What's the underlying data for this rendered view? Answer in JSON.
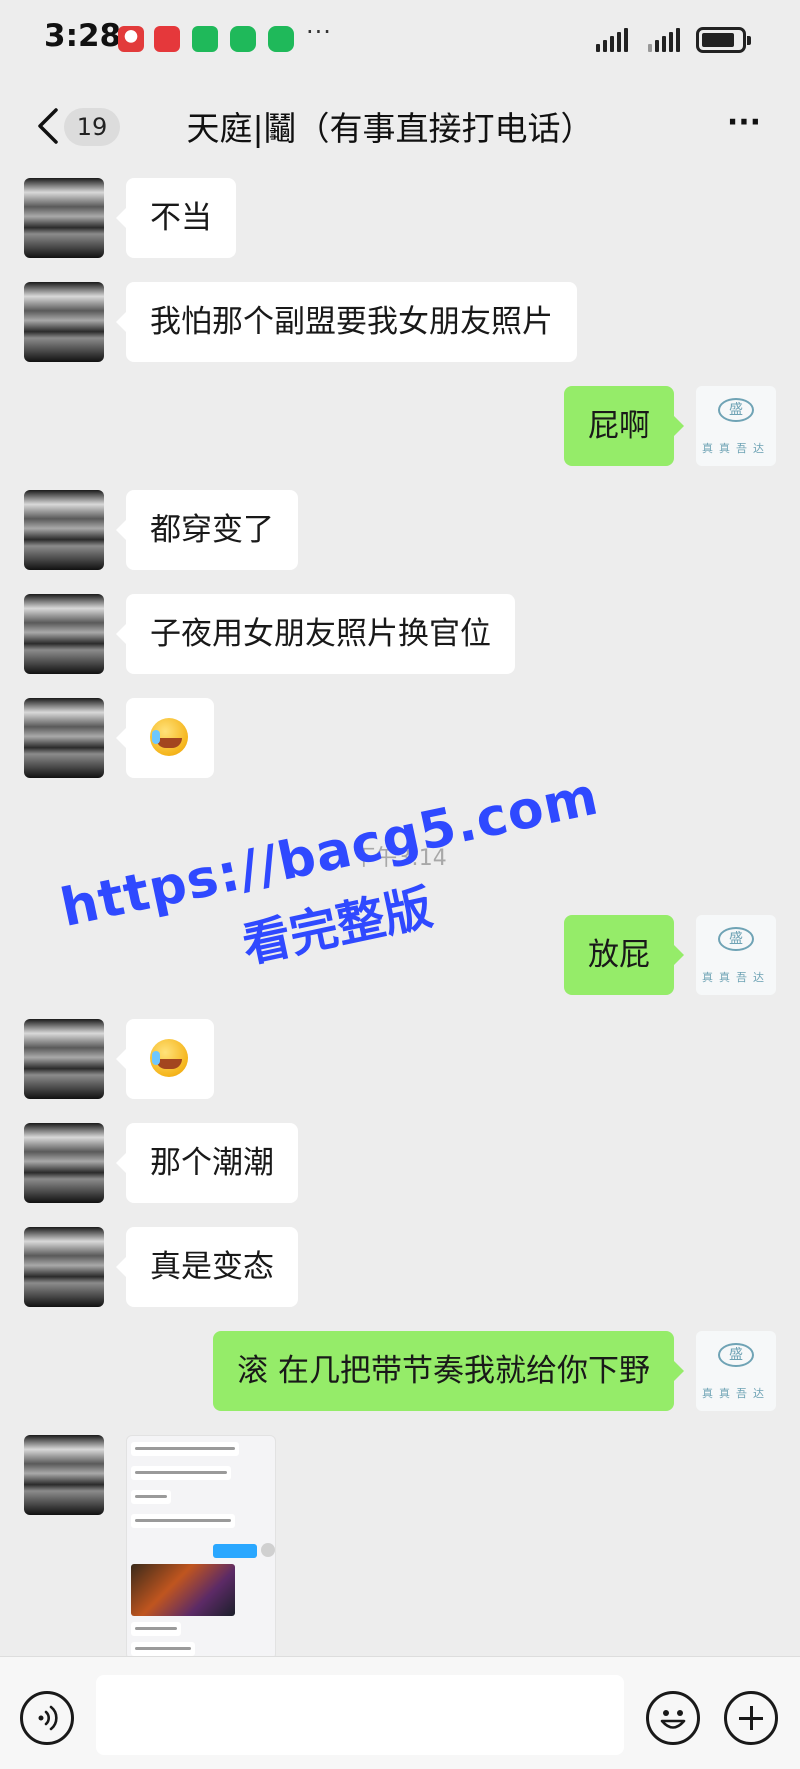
{
  "status_bar": {
    "time": "3:28",
    "more_indicator": "···",
    "notification_icons": [
      "app-notification-icon",
      "red-app-icon",
      "green-app-icon",
      "wechat-icon",
      "wechat-icon"
    ],
    "battery_level_fraction": 0.75
  },
  "header": {
    "unread_count": "19",
    "title": "天庭|鬮（有事直接打电话）",
    "more_label": "···"
  },
  "timestamp": "下午3:14",
  "messages": [
    {
      "side": "left",
      "text": "不当"
    },
    {
      "side": "left",
      "text": "我怕那个副盟要我女朋友照片"
    },
    {
      "side": "right",
      "text": "屁啊"
    },
    {
      "side": "left",
      "text": "都穿变了"
    },
    {
      "side": "left",
      "text": "子夜用女朋友照片换官位"
    },
    {
      "side": "left",
      "emoji": "face-with-tears-of-joy-emoji"
    },
    {
      "side": "right",
      "text": "放屁"
    },
    {
      "side": "left",
      "emoji": "face-holding-back-tears-emoji"
    },
    {
      "side": "left",
      "text": "那个潮潮"
    },
    {
      "side": "left",
      "text": "真是变态"
    },
    {
      "side": "right",
      "text": "滚 在几把带节奏我就给你下野"
    },
    {
      "side": "left",
      "image": "chat-screenshot-image"
    }
  ],
  "self_avatar": {
    "seal_char": "盛",
    "signature": "真真吾达"
  },
  "watermark": {
    "url": "https://bacg5.com",
    "caption": "看完整版"
  },
  "input_bar": {
    "placeholder": "",
    "icons": [
      "voice-icon",
      "emoji-icon",
      "plus-icon"
    ]
  },
  "colors": {
    "background": "#ededed",
    "left_bubble": "#ffffff",
    "right_bubble": "#95ec69",
    "watermark": "#2f49ff"
  }
}
